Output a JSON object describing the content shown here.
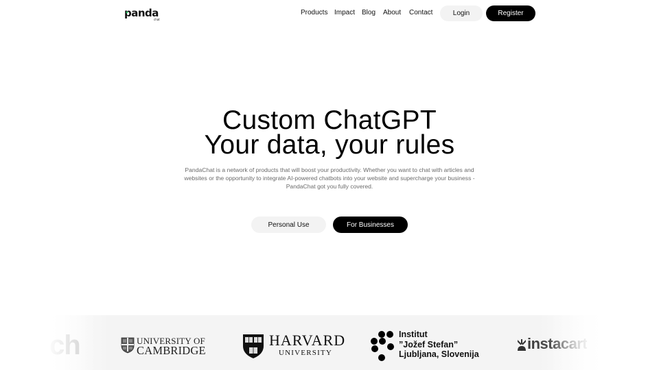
{
  "header": {
    "logo_text": "panda",
    "logo_subtext": "chat",
    "nav": [
      "Products",
      "Impact",
      "Blog",
      "About",
      "Contact"
    ],
    "login_label": "Login",
    "register_label": "Register"
  },
  "hero": {
    "title_line1": "Custom ChatGPT",
    "title_line2": "Your data, your rules",
    "description": "PandaChat is a network of products that will boost your productivity. Whether you want to chat with articles and websites or the opportunity to integrate AI-powered chatbots into your website and supercharge your business - PandaChat got you fully covered.",
    "personal_label": "Personal Use",
    "business_label": "For Businesses"
  },
  "partners": {
    "partial_logo": "ch",
    "cambridge_line1": "UNIVERSITY OF",
    "cambridge_line2": "CAMBRIDGE",
    "harvard_line1": "HARVARD",
    "harvard_line2": "UNIVERSITY",
    "ijs_line1": "Institut",
    "ijs_line2": "”Jožef Stefan”",
    "ijs_line3": "Ljubljana, Slovenija",
    "instacart": "instacart"
  },
  "colors": {
    "primary": "#000000",
    "light_button": "#f3f3f3",
    "muted_text": "#6b6b6b",
    "logo_accent": "#22c55e",
    "strip_bg": "#f4f4f4"
  }
}
